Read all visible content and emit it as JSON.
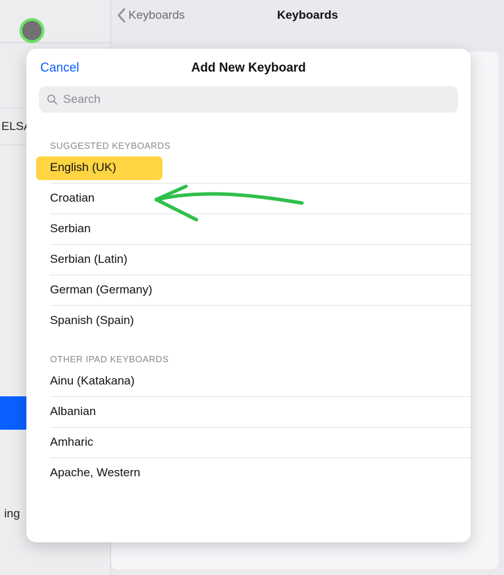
{
  "background": {
    "nav_back_label": "Keyboards",
    "nav_title": "Keyboards",
    "side_text_partial_1": "ELSA",
    "side_text_partial_2": "ing"
  },
  "modal": {
    "cancel_label": "Cancel",
    "title": "Add New Keyboard",
    "search_placeholder": "Search",
    "sections": {
      "suggested_header": "SUGGESTED KEYBOARDS",
      "other_header": "OTHER IPAD KEYBOARDS"
    },
    "suggested": [
      {
        "label": "English (UK)"
      },
      {
        "label": "Croatian"
      },
      {
        "label": "Serbian"
      },
      {
        "label": "Serbian (Latin)"
      },
      {
        "label": "German (Germany)"
      },
      {
        "label": "Spanish (Spain)"
      }
    ],
    "other": [
      {
        "label": "Ainu (Katakana)"
      },
      {
        "label": "Albanian"
      },
      {
        "label": "Amharic"
      },
      {
        "label": "Apache, Western"
      }
    ]
  },
  "annotation": {
    "highlighted_item": 0,
    "arrow_color": "#34c759"
  }
}
